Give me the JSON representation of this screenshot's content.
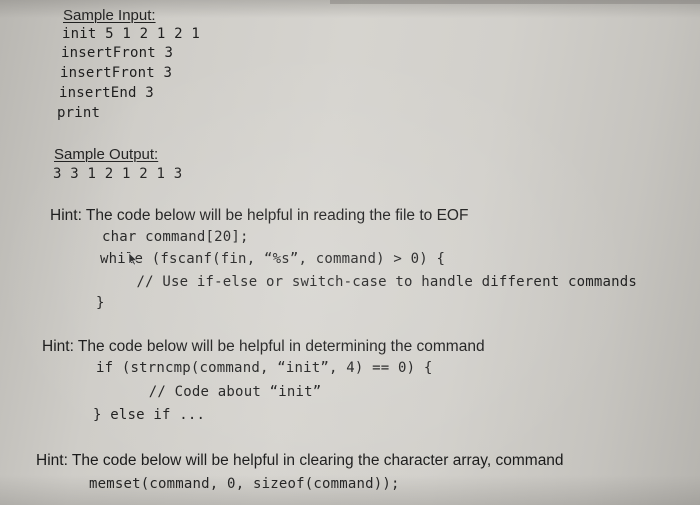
{
  "sample_input": {
    "heading": "Sample Input:",
    "lines": [
      "init 5 1 2 1 2 1",
      "insertFront 3",
      "insertFront 3",
      "insertEnd 3",
      "print"
    ]
  },
  "sample_output": {
    "heading": "Sample Output:",
    "lines": [
      "3 3 1 2 1 2 1 3"
    ]
  },
  "hints": [
    {
      "text": "Hint: The code below will be helpful in reading the file to EOF",
      "code": [
        "char command[20];",
        "while (fscanf(fin, “%s”, command) > 0) {",
        "    // Use if-else or switch-case to handle different commands",
        "}"
      ]
    },
    {
      "text": "Hint: The code below will be helpful in determining the command",
      "code": [
        "if (strncmp(command, “init”, 4) == 0) {",
        "      // Code about “init”",
        "} else if ..."
      ]
    },
    {
      "text": "Hint: The code below will be helpful in clearing the character array, command",
      "code": [
        "memset(command, 0, sizeof(command));"
      ]
    }
  ]
}
